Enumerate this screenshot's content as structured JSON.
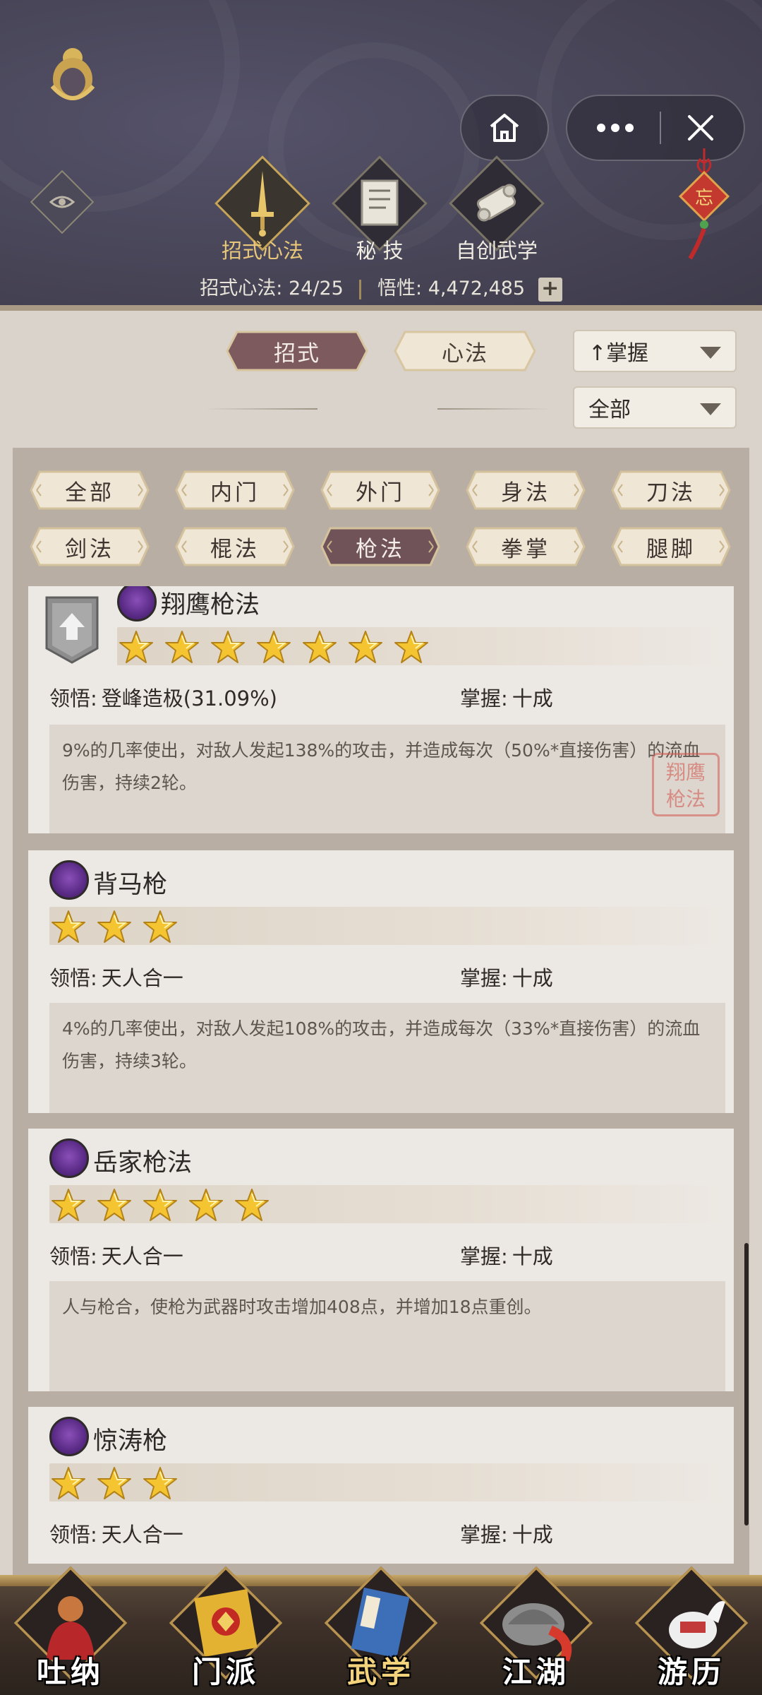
{
  "header": {
    "tabs": [
      {
        "label": "招式心法",
        "icon": "sword-icon",
        "active": true
      },
      {
        "label": "秘 技",
        "icon": "book-icon",
        "active": false
      },
      {
        "label": "自创武学",
        "icon": "scroll-icon",
        "active": false
      }
    ],
    "stats": {
      "skills_label": "招式心法:",
      "skills_value": "24/25",
      "insight_label": "悟性:",
      "insight_value": "4,472,485",
      "plus": "+"
    },
    "charm_text": "忘"
  },
  "filter": {
    "type_buttons": [
      {
        "label": "招式",
        "active": true
      },
      {
        "label": "心法",
        "active": false
      }
    ],
    "sort_dropdown": "↑掌握",
    "range_dropdown": "全部"
  },
  "categories": [
    {
      "label": "全部",
      "active": false
    },
    {
      "label": "内门",
      "active": false
    },
    {
      "label": "外门",
      "active": false
    },
    {
      "label": "身法",
      "active": false
    },
    {
      "label": "刀法",
      "active": false
    },
    {
      "label": "剑法",
      "active": false
    },
    {
      "label": "棍法",
      "active": false
    },
    {
      "label": "枪法",
      "active": true
    },
    {
      "label": "拳掌",
      "active": false
    },
    {
      "label": "腿脚",
      "active": false
    }
  ],
  "skills": [
    {
      "name": "翔鹰枪法",
      "stars": 7,
      "comprehension_label": "领悟:",
      "comprehension_value": "登峰造极(31.09%)",
      "mastery_label": "掌握:",
      "mastery_value": "十成",
      "description": "9%的几率使出，对敌人发起138%的攻击，并造成每次（50%*直接伤害）的流血伤害，持续2轮。",
      "seal": "翔鹰枪法"
    },
    {
      "name": "背马枪",
      "stars": 3,
      "comprehension_label": "领悟:",
      "comprehension_value": "天人合一",
      "mastery_label": "掌握:",
      "mastery_value": "十成",
      "description": "4%的几率使出，对敌人发起108%的攻击，并造成每次（33%*直接伤害）的流血伤害，持续3轮。"
    },
    {
      "name": "岳家枪法",
      "stars": 5,
      "comprehension_label": "领悟:",
      "comprehension_value": "天人合一",
      "mastery_label": "掌握:",
      "mastery_value": "十成",
      "description": "人与枪合，使枪为武器时攻击增加408点，并增加18点重创。"
    },
    {
      "name": "惊涛枪",
      "stars": 3,
      "comprehension_label": "领悟:",
      "comprehension_value": "天人合一",
      "mastery_label": "掌握:",
      "mastery_value": "十成"
    }
  ],
  "bottom_nav": [
    {
      "label": "吐纳",
      "icon": "monk-icon",
      "active": false
    },
    {
      "label": "门派",
      "icon": "banner-icon",
      "active": false
    },
    {
      "label": "武学",
      "icon": "manual-icon",
      "active": true
    },
    {
      "label": "江湖",
      "icon": "hat-icon",
      "active": false
    },
    {
      "label": "游历",
      "icon": "horse-icon",
      "active": false
    }
  ]
}
